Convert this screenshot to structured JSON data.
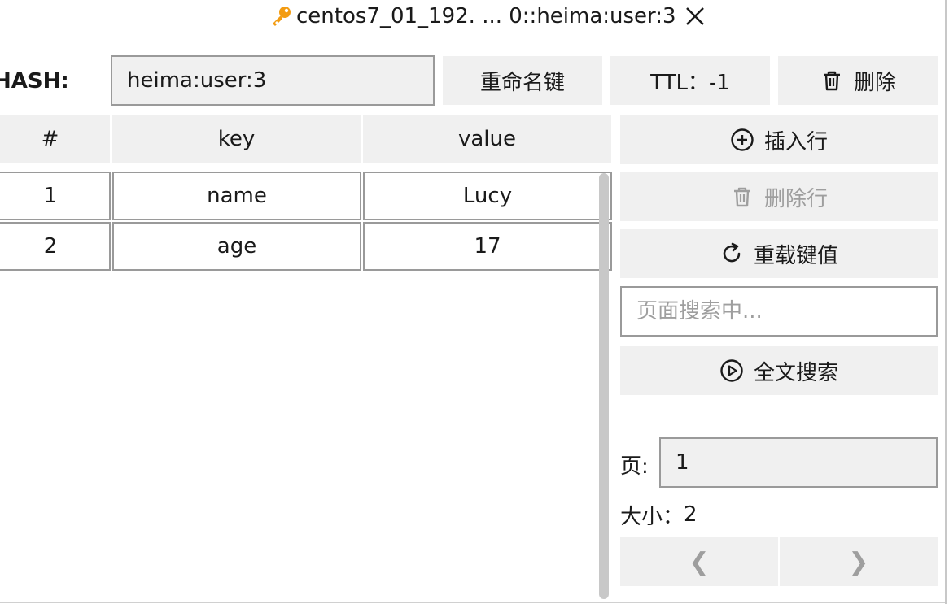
{
  "tab": {
    "title": "centos7_01_192. ... 0::heima:user:3"
  },
  "key_bar": {
    "type_label": "HASH:",
    "key_value": "heima:user:3",
    "rename_label": "重命名键",
    "ttl_label": "TTL：-1",
    "delete_label": "删除"
  },
  "table": {
    "headers": [
      "#",
      "key",
      "value"
    ],
    "rows": [
      {
        "index": "1",
        "key": "name",
        "value": "Lucy"
      },
      {
        "index": "2",
        "key": "age",
        "value": "17"
      }
    ]
  },
  "actions": {
    "insert_row": "插入行",
    "delete_row": "删除行",
    "reload": "重载键值",
    "search_placeholder": "页面搜索中...",
    "fulltext_search": "全文搜索"
  },
  "paging": {
    "page_label": "页:",
    "page_value": "1",
    "size_label": "大小：",
    "size_value": "2",
    "prev_symbol": "❮",
    "next_symbol": "❯"
  },
  "icons": {
    "key": "key-icon",
    "close": "close-icon",
    "trash": "trash-icon",
    "plus_circle": "plus-circle-icon",
    "reload": "reload-icon",
    "play_circle": "play-circle-icon"
  },
  "colors": {
    "key_icon": "#f39c12",
    "button_bg": "#f0f0f0",
    "border": "#9a9a9a",
    "disabled_text": "#9e9e9e"
  }
}
